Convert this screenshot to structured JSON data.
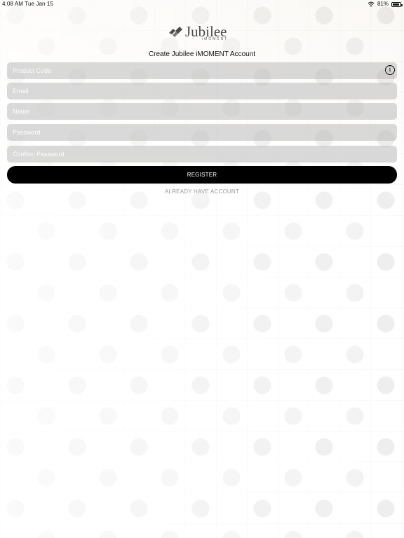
{
  "status_bar": {
    "time": "4:08 AM",
    "date": "Tue Jan 15",
    "battery": "81%",
    "battery_level": 0.81,
    "wifi_icon": "wifi-icon",
    "battery_icon": "battery-icon"
  },
  "logo": {
    "text": "Jubilee",
    "subtext": "iMOMENT",
    "icon": "jubilee-logo-icon"
  },
  "page": {
    "title": "Create Jubilee iMOMENT Account"
  },
  "form": {
    "product_code": {
      "placeholder": "Product Code",
      "value": "",
      "info_icon": "info-icon"
    },
    "email": {
      "placeholder": "Email",
      "value": ""
    },
    "name": {
      "placeholder": "Name",
      "value": ""
    },
    "password": {
      "placeholder": "Password",
      "value": ""
    },
    "confirm_password": {
      "placeholder": "Confirm Password",
      "value": ""
    }
  },
  "actions": {
    "register_label": "REGISTER",
    "already_have_account_label": "ALREADY HAVE ACCOUNT"
  },
  "colors": {
    "button_background": "#000000",
    "button_text": "#ffffff",
    "field_background": "#b0b0b0",
    "secondary_text": "#9a9a9a"
  }
}
